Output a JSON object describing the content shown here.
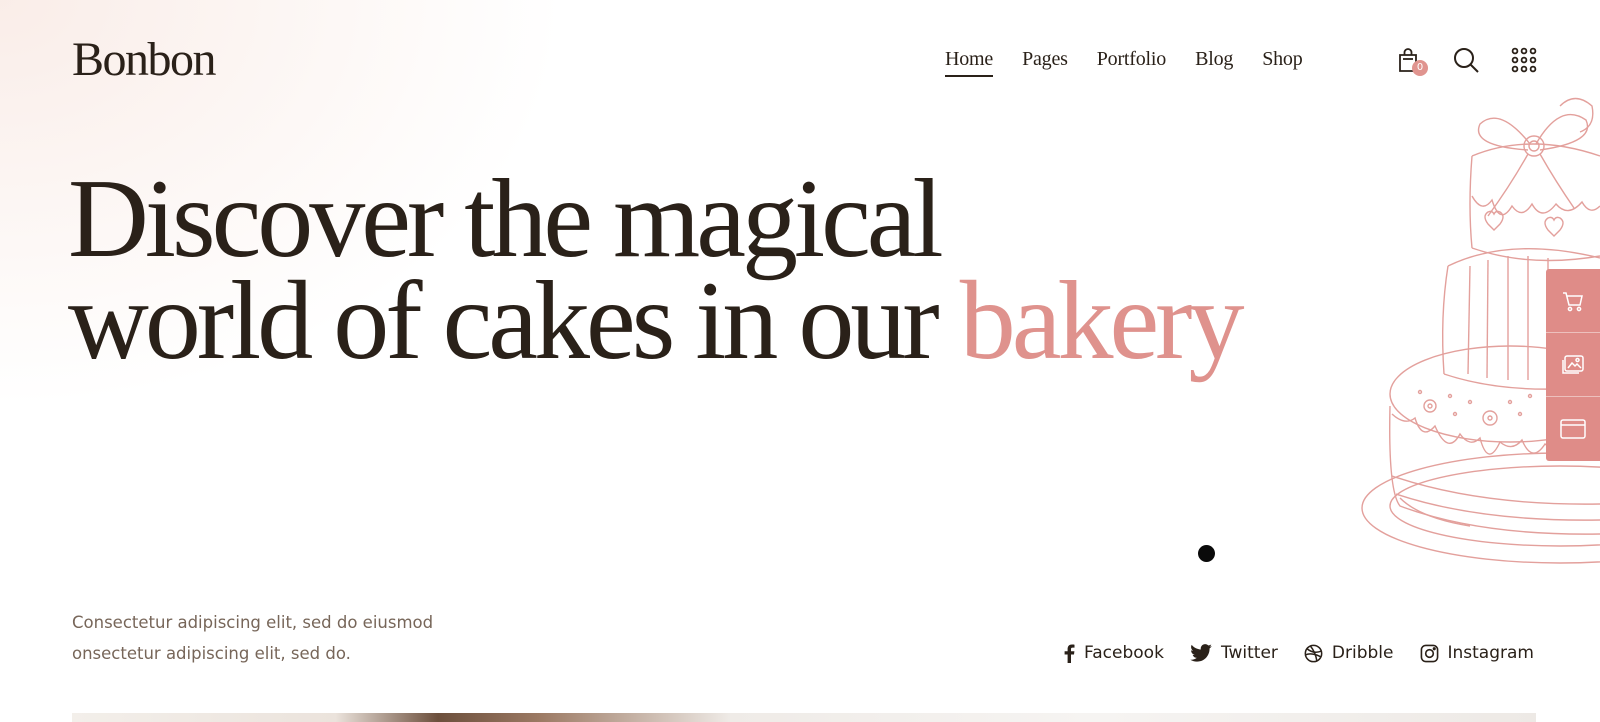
{
  "brand": {
    "logo": "Bonbon"
  },
  "nav": {
    "items": [
      {
        "label": "Home"
      },
      {
        "label": "Pages"
      },
      {
        "label": "Portfolio"
      },
      {
        "label": "Blog"
      },
      {
        "label": "Shop"
      }
    ]
  },
  "header": {
    "cart_count": "0",
    "icons": [
      "shopping-bag-icon",
      "search-icon",
      "grid-menu-icon"
    ]
  },
  "hero": {
    "title_line1": "Discover the magical",
    "title_line2": "world of cakes in our",
    "title_accent": "bakery",
    "intro_line1": "Consectetur adipiscing elit, sed do eiusmod",
    "intro_line2": "onsectetur adipiscing elit, sed do."
  },
  "side_buttons": [
    "cart-icon",
    "gallery-icon",
    "window-icon"
  ],
  "social": {
    "links": [
      {
        "label": "Facebook",
        "icon": "facebook-icon"
      },
      {
        "label": "Twitter",
        "icon": "twitter-icon"
      },
      {
        "label": "Dribble",
        "icon": "dribbble-icon"
      },
      {
        "label": "Instagram",
        "icon": "instagram-icon"
      }
    ]
  },
  "colors": {
    "text": "#2a2119",
    "accent": "#df928d",
    "muted": "#776659",
    "side_button": "#df8c88"
  }
}
